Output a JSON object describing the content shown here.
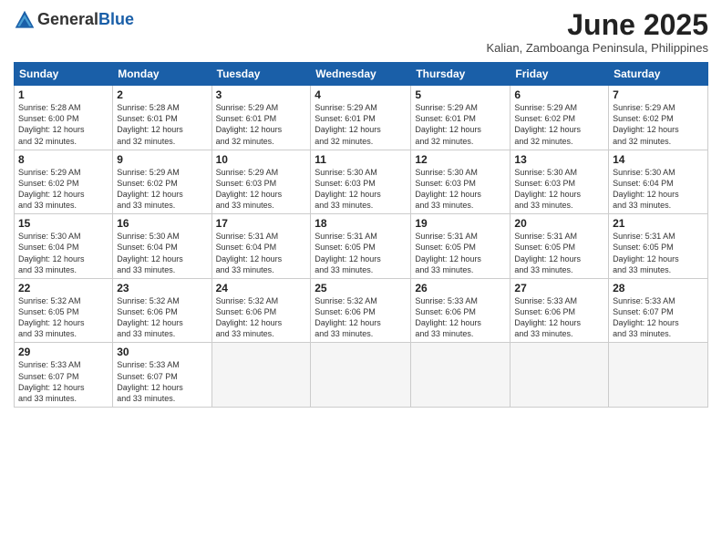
{
  "logo": {
    "general": "General",
    "blue": "Blue"
  },
  "title": "June 2025",
  "location": "Kalian, Zamboanga Peninsula, Philippines",
  "headers": [
    "Sunday",
    "Monday",
    "Tuesday",
    "Wednesday",
    "Thursday",
    "Friday",
    "Saturday"
  ],
  "weeks": [
    [
      {
        "day": "1",
        "info": "Sunrise: 5:28 AM\nSunset: 6:00 PM\nDaylight: 12 hours\nand 32 minutes."
      },
      {
        "day": "2",
        "info": "Sunrise: 5:28 AM\nSunset: 6:01 PM\nDaylight: 12 hours\nand 32 minutes."
      },
      {
        "day": "3",
        "info": "Sunrise: 5:29 AM\nSunset: 6:01 PM\nDaylight: 12 hours\nand 32 minutes."
      },
      {
        "day": "4",
        "info": "Sunrise: 5:29 AM\nSunset: 6:01 PM\nDaylight: 12 hours\nand 32 minutes."
      },
      {
        "day": "5",
        "info": "Sunrise: 5:29 AM\nSunset: 6:01 PM\nDaylight: 12 hours\nand 32 minutes."
      },
      {
        "day": "6",
        "info": "Sunrise: 5:29 AM\nSunset: 6:02 PM\nDaylight: 12 hours\nand 32 minutes."
      },
      {
        "day": "7",
        "info": "Sunrise: 5:29 AM\nSunset: 6:02 PM\nDaylight: 12 hours\nand 32 minutes."
      }
    ],
    [
      {
        "day": "8",
        "info": "Sunrise: 5:29 AM\nSunset: 6:02 PM\nDaylight: 12 hours\nand 33 minutes."
      },
      {
        "day": "9",
        "info": "Sunrise: 5:29 AM\nSunset: 6:02 PM\nDaylight: 12 hours\nand 33 minutes."
      },
      {
        "day": "10",
        "info": "Sunrise: 5:29 AM\nSunset: 6:03 PM\nDaylight: 12 hours\nand 33 minutes."
      },
      {
        "day": "11",
        "info": "Sunrise: 5:30 AM\nSunset: 6:03 PM\nDaylight: 12 hours\nand 33 minutes."
      },
      {
        "day": "12",
        "info": "Sunrise: 5:30 AM\nSunset: 6:03 PM\nDaylight: 12 hours\nand 33 minutes."
      },
      {
        "day": "13",
        "info": "Sunrise: 5:30 AM\nSunset: 6:03 PM\nDaylight: 12 hours\nand 33 minutes."
      },
      {
        "day": "14",
        "info": "Sunrise: 5:30 AM\nSunset: 6:04 PM\nDaylight: 12 hours\nand 33 minutes."
      }
    ],
    [
      {
        "day": "15",
        "info": "Sunrise: 5:30 AM\nSunset: 6:04 PM\nDaylight: 12 hours\nand 33 minutes."
      },
      {
        "day": "16",
        "info": "Sunrise: 5:30 AM\nSunset: 6:04 PM\nDaylight: 12 hours\nand 33 minutes."
      },
      {
        "day": "17",
        "info": "Sunrise: 5:31 AM\nSunset: 6:04 PM\nDaylight: 12 hours\nand 33 minutes."
      },
      {
        "day": "18",
        "info": "Sunrise: 5:31 AM\nSunset: 6:05 PM\nDaylight: 12 hours\nand 33 minutes."
      },
      {
        "day": "19",
        "info": "Sunrise: 5:31 AM\nSunset: 6:05 PM\nDaylight: 12 hours\nand 33 minutes."
      },
      {
        "day": "20",
        "info": "Sunrise: 5:31 AM\nSunset: 6:05 PM\nDaylight: 12 hours\nand 33 minutes."
      },
      {
        "day": "21",
        "info": "Sunrise: 5:31 AM\nSunset: 6:05 PM\nDaylight: 12 hours\nand 33 minutes."
      }
    ],
    [
      {
        "day": "22",
        "info": "Sunrise: 5:32 AM\nSunset: 6:05 PM\nDaylight: 12 hours\nand 33 minutes."
      },
      {
        "day": "23",
        "info": "Sunrise: 5:32 AM\nSunset: 6:06 PM\nDaylight: 12 hours\nand 33 minutes."
      },
      {
        "day": "24",
        "info": "Sunrise: 5:32 AM\nSunset: 6:06 PM\nDaylight: 12 hours\nand 33 minutes."
      },
      {
        "day": "25",
        "info": "Sunrise: 5:32 AM\nSunset: 6:06 PM\nDaylight: 12 hours\nand 33 minutes."
      },
      {
        "day": "26",
        "info": "Sunrise: 5:33 AM\nSunset: 6:06 PM\nDaylight: 12 hours\nand 33 minutes."
      },
      {
        "day": "27",
        "info": "Sunrise: 5:33 AM\nSunset: 6:06 PM\nDaylight: 12 hours\nand 33 minutes."
      },
      {
        "day": "28",
        "info": "Sunrise: 5:33 AM\nSunset: 6:07 PM\nDaylight: 12 hours\nand 33 minutes."
      }
    ],
    [
      {
        "day": "29",
        "info": "Sunrise: 5:33 AM\nSunset: 6:07 PM\nDaylight: 12 hours\nand 33 minutes."
      },
      {
        "day": "30",
        "info": "Sunrise: 5:33 AM\nSunset: 6:07 PM\nDaylight: 12 hours\nand 33 minutes."
      },
      {
        "day": "",
        "info": ""
      },
      {
        "day": "",
        "info": ""
      },
      {
        "day": "",
        "info": ""
      },
      {
        "day": "",
        "info": ""
      },
      {
        "day": "",
        "info": ""
      }
    ]
  ]
}
